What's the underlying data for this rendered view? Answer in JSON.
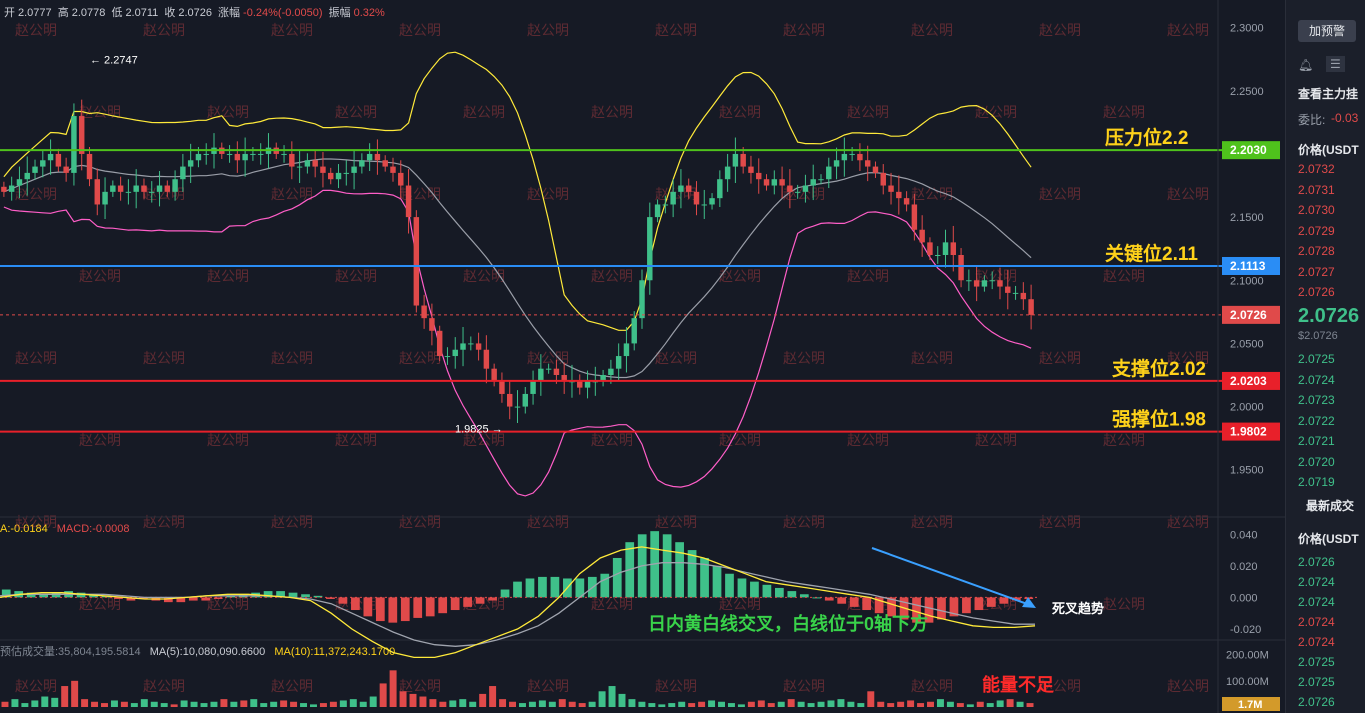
{
  "header": {
    "open_label": "开",
    "open": "2.0777",
    "high_label": "高",
    "high": "2.0778",
    "low_label": "低",
    "low": "2.0711",
    "close_label": "收",
    "close": "2.0726",
    "change_label": "涨幅",
    "change": "-0.24%(-0.0050)",
    "amplitude_label": "振幅",
    "amplitude": "0.32%"
  },
  "macd_header": {
    "dif": "A:-0.0184",
    "macd": "MACD:-0.0008"
  },
  "volume_header": {
    "est": "预估成交量:35,804,195.5814",
    "ma5": "MA(5):10,080,090.6600",
    "ma10": "MA(10):11,372,243.1700"
  },
  "annotations": {
    "high_marker": "← 2.2747",
    "low_marker": "1.9825 →",
    "resistance": "压力位2.2",
    "key": "关键位2.11",
    "support": "支撑位2.02",
    "strong_support": "强撑位1.98",
    "macd_note": "日内黄白线交叉，白线位于0轴下方",
    "death_cross": "死叉趋势",
    "volume_note": "能量不足"
  },
  "watermark": "赵公明",
  "colors": {
    "bg": "#161a25",
    "up": "#3fc08a",
    "down": "#e04a4a",
    "resistance": "#4fc21c",
    "key": "#2a8df5",
    "support": "#e8202a",
    "current": "#e04a4a",
    "volume_badge": "#d39a2a"
  },
  "right_panel": {
    "button": "加预警",
    "icon_a": "bell-icon",
    "icon_b": "layout-icon",
    "view_orders": "查看主力挂",
    "ratio_label": "委比:",
    "ratio_value": "-0.03",
    "price_header": "价格(USDT",
    "asks": [
      "2.0732",
      "2.0731",
      "2.0730",
      "2.0729",
      "2.0728",
      "2.0727",
      "2.0726"
    ],
    "last_price": "2.0726",
    "last_price_sub": "$2.0726",
    "bids": [
      "2.0725",
      "2.0724",
      "2.0723",
      "2.0722",
      "2.0721",
      "2.0720",
      "2.0719"
    ],
    "trades_title": "最新成交",
    "trades_header": "价格(USDT",
    "trades": [
      "2.0726",
      "2.0724",
      "2.0724",
      "2.0724",
      "2.0724",
      "2.0725",
      "2.0725",
      "2.0726"
    ]
  },
  "chart_data": [
    {
      "type": "candlestick",
      "title": "",
      "ylim": [
        1.93,
        2.31
      ],
      "ytick_labels": [
        "2.3000",
        "2.2500",
        "2.2000",
        "2.1500",
        "2.1000",
        "2.0500",
        "2.0000",
        "1.9500"
      ],
      "ytick_values": [
        2.3,
        2.25,
        2.2,
        2.15,
        2.1,
        2.05,
        2.0,
        1.95
      ],
      "close_series": [
        2.17,
        2.175,
        2.18,
        2.185,
        2.19,
        2.195,
        2.2,
        2.19,
        2.185,
        2.23,
        2.2,
        2.18,
        2.16,
        2.17,
        2.175,
        2.17,
        2.17,
        2.175,
        2.17,
        2.17,
        2.175,
        2.17,
        2.18,
        2.19,
        2.195,
        2.2,
        2.2,
        2.205,
        2.2,
        2.2,
        2.195,
        2.2,
        2.2,
        2.2,
        2.205,
        2.2,
        2.2,
        2.19,
        2.19,
        2.195,
        2.19,
        2.185,
        2.18,
        2.185,
        2.185,
        2.19,
        2.195,
        2.2,
        2.195,
        2.19,
        2.185,
        2.175,
        2.15,
        2.08,
        2.07,
        2.06,
        2.04,
        2.04,
        2.045,
        2.05,
        2.05,
        2.045,
        2.03,
        2.02,
        2.01,
        2.0,
        2.0,
        2.01,
        2.02,
        2.03,
        2.03,
        2.025,
        2.02,
        2.02,
        2.015,
        2.02,
        2.02,
        2.025,
        2.03,
        2.04,
        2.05,
        2.07,
        2.1,
        2.15,
        2.16,
        2.16,
        2.17,
        2.175,
        2.17,
        2.16,
        2.16,
        2.165,
        2.18,
        2.19,
        2.2,
        2.19,
        2.185,
        2.18,
        2.175,
        2.18,
        2.175,
        2.17,
        2.17,
        2.175,
        2.18,
        2.18,
        2.19,
        2.195,
        2.2,
        2.2,
        2.195,
        2.19,
        2.185,
        2.175,
        2.17,
        2.165,
        2.16,
        2.14,
        2.13,
        2.12,
        2.12,
        2.13,
        2.12,
        2.1,
        2.1,
        2.095,
        2.1,
        2.1,
        2.095,
        2.09,
        2.09,
        2.085,
        2.0726
      ],
      "levels": [
        {
          "label": "压力位2.2",
          "value": 2.203,
          "badge": "2.2030"
        },
        {
          "label": "关键位2.11",
          "value": 2.1113,
          "badge": "2.1113"
        },
        {
          "label": "支撑位2.02",
          "value": 2.0203,
          "badge": "2.0203"
        },
        {
          "label": "强撑位1.98",
          "value": 1.9802,
          "badge": "1.9802"
        }
      ],
      "current_price": {
        "value": 2.0726,
        "badge": "2.0726"
      },
      "high_marker": 2.2747,
      "low_marker": 1.9825
    },
    {
      "type": "bar",
      "title": "",
      "ylim": [
        -0.027,
        0.044
      ],
      "ytick_labels": [
        "0.040",
        "0.020",
        "0.000",
        "-0.020"
      ],
      "ytick_values": [
        0.04,
        0.02,
        0.0,
        -0.02
      ],
      "hist": [
        0.005,
        0.004,
        0.003,
        0.002,
        0.003,
        0.004,
        0.003,
        0.002,
        0.001,
        -0.001,
        -0.002,
        -0.001,
        -0.002,
        -0.003,
        -0.003,
        -0.002,
        -0.002,
        -0.001,
        0.001,
        0.002,
        0.003,
        0.004,
        0.004,
        0.003,
        0.002,
        0.001,
        -0.001,
        -0.004,
        -0.008,
        -0.012,
        -0.015,
        -0.016,
        -0.015,
        -0.013,
        -0.012,
        -0.01,
        -0.008,
        -0.006,
        -0.004,
        -0.002,
        0.005,
        0.01,
        0.012,
        0.013,
        0.013,
        0.012,
        0.012,
        0.013,
        0.015,
        0.025,
        0.035,
        0.04,
        0.042,
        0.04,
        0.035,
        0.03,
        0.025,
        0.02,
        0.015,
        0.012,
        0.01,
        0.008,
        0.006,
        0.004,
        0.002,
        0.0,
        -0.002,
        -0.004,
        -0.006,
        -0.008,
        -0.01,
        -0.012,
        -0.014,
        -0.016,
        -0.016,
        -0.014,
        -0.012,
        -0.01,
        -0.008,
        -0.006,
        -0.004,
        -0.002,
        -0.001
      ],
      "dif": [
        0.0,
        0.002,
        0.003,
        0.003,
        0.002,
        0.001,
        0.0,
        -0.001,
        -0.001,
        0.0,
        0.001,
        0.002,
        0.002,
        0.001,
        0.0,
        -0.002,
        -0.01,
        -0.02,
        -0.028,
        -0.035,
        -0.038,
        -0.038,
        -0.035,
        -0.03,
        -0.025,
        -0.02,
        -0.012,
        0.0,
        0.015,
        0.025,
        0.03,
        0.032,
        0.03,
        0.028,
        0.025,
        0.02,
        0.015,
        0.01,
        0.008,
        0.006,
        0.004,
        0.002,
        0.0,
        -0.004,
        -0.008,
        -0.012,
        -0.015,
        -0.018,
        -0.019,
        -0.019,
        -0.018
      ],
      "dea": [
        0.001,
        0.002,
        0.002,
        0.002,
        0.002,
        0.002,
        0.001,
        0.0,
        0.0,
        0.0,
        0.001,
        0.001,
        0.001,
        0.001,
        0.0,
        -0.001,
        -0.004,
        -0.01,
        -0.016,
        -0.022,
        -0.027,
        -0.03,
        -0.031,
        -0.03,
        -0.027,
        -0.023,
        -0.018,
        -0.01,
        0.0,
        0.01,
        0.016,
        0.02,
        0.022,
        0.022,
        0.021,
        0.019,
        0.016,
        0.013,
        0.01,
        0.008,
        0.006,
        0.004,
        0.002,
        -0.001,
        -0.004,
        -0.007,
        -0.01,
        -0.013,
        -0.015,
        -0.017,
        -0.017
      ]
    },
    {
      "type": "bar",
      "title": "",
      "ylim": [
        0,
        210
      ],
      "ytick_labels": [
        "200.00M",
        "100.00M"
      ],
      "ytick_values": [
        200,
        100
      ],
      "volume_badge": "1.7M",
      "volume": [
        20,
        30,
        15,
        25,
        40,
        35,
        80,
        100,
        30,
        20,
        15,
        25,
        20,
        15,
        30,
        20,
        15,
        10,
        25,
        20,
        15,
        20,
        30,
        20,
        25,
        30,
        15,
        20,
        25,
        20,
        15,
        10,
        15,
        20,
        25,
        30,
        20,
        40,
        90,
        140,
        60,
        50,
        40,
        30,
        20,
        25,
        30,
        20,
        50,
        80,
        30,
        20,
        15,
        20,
        25,
        20,
        30,
        20,
        15,
        20,
        60,
        80,
        50,
        30,
        20,
        15,
        10,
        15,
        20,
        15,
        20,
        25,
        20,
        15,
        10,
        20,
        25,
        15,
        20,
        30,
        20,
        15,
        20,
        25,
        30,
        20,
        15,
        60,
        20,
        15,
        20,
        25,
        15,
        20,
        30,
        20,
        15,
        10,
        20,
        15,
        25,
        30,
        20,
        15
      ]
    }
  ]
}
